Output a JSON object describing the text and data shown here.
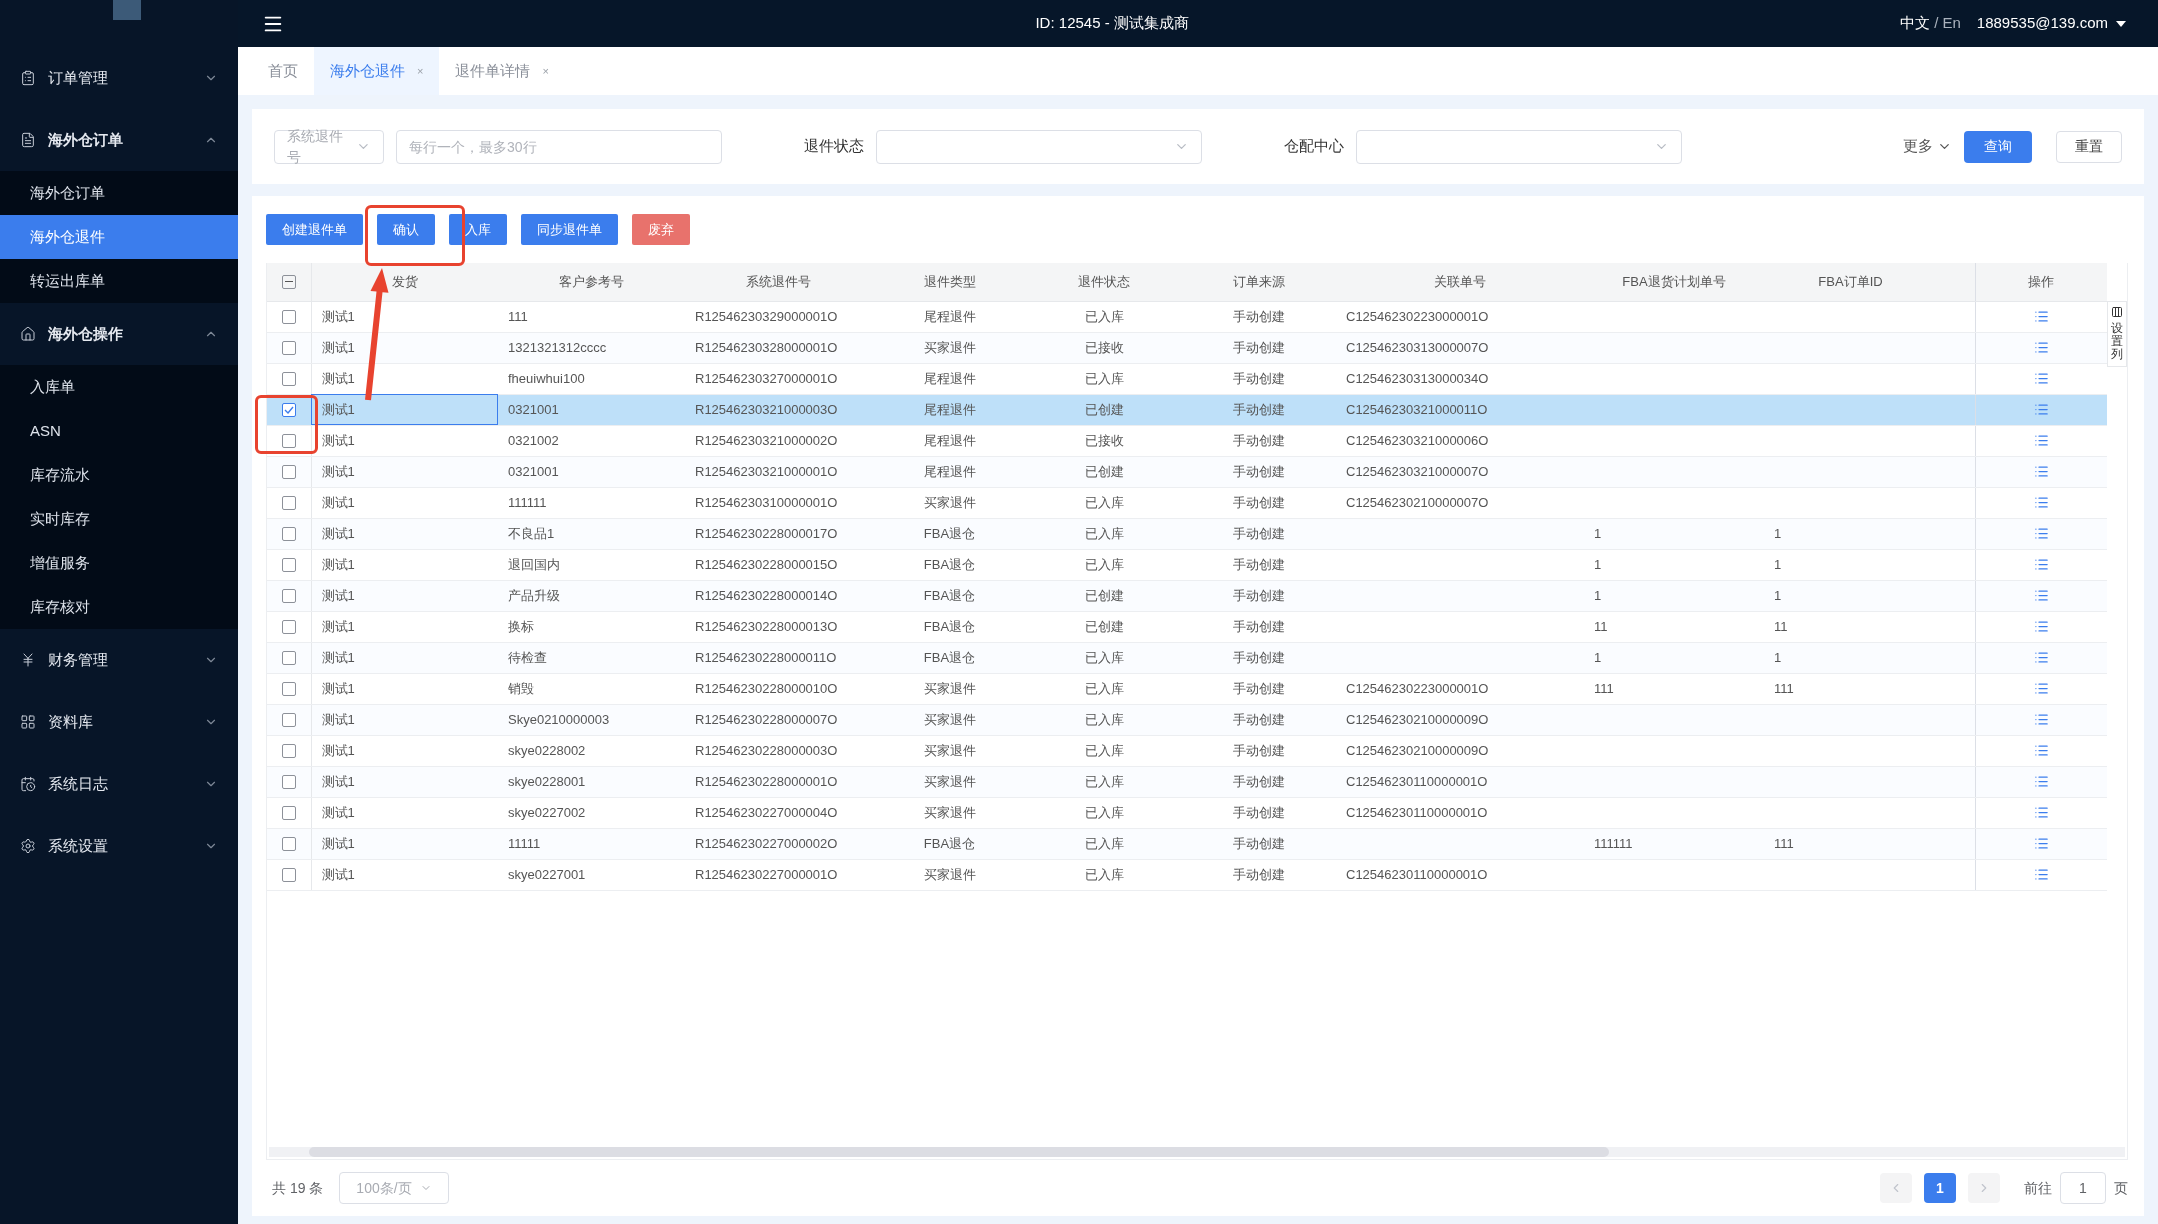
{
  "header": {
    "title": "ID: 12545 - 测试集成商",
    "lang_current": "中文",
    "lang_separator": "/",
    "lang_other": "En",
    "user": "1889535@139.com"
  },
  "sidebar": {
    "items": [
      {
        "label": "订单管理",
        "expanded": false
      },
      {
        "label": "海外仓订单",
        "expanded": true,
        "children": [
          {
            "label": "海外仓订单",
            "selected": false
          },
          {
            "label": "海外仓退件",
            "selected": true
          },
          {
            "label": "转运出库单",
            "selected": false
          }
        ]
      },
      {
        "label": "海外仓操作",
        "expanded": true,
        "children": [
          {
            "label": "入库单",
            "selected": false
          },
          {
            "label": "ASN",
            "selected": false
          },
          {
            "label": "库存流水",
            "selected": false
          },
          {
            "label": "实时库存",
            "selected": false
          },
          {
            "label": "增值服务",
            "selected": false
          },
          {
            "label": "库存核对",
            "selected": false
          }
        ]
      },
      {
        "label": "财务管理",
        "expanded": false
      },
      {
        "label": "资料库",
        "expanded": false
      },
      {
        "label": "系统日志",
        "expanded": false
      },
      {
        "label": "系统设置",
        "expanded": false
      }
    ]
  },
  "tabs": [
    {
      "label": "首页",
      "selected": false
    },
    {
      "label": "海外仓退件",
      "selected": true,
      "close": "×"
    },
    {
      "label": "退件单详情",
      "selected": false,
      "close": "×"
    }
  ],
  "filters": {
    "field_select": "系统退件号",
    "input_placeholder": "每行一个，最多30行",
    "status_label": "退件状态",
    "center_label": "仓配中心",
    "more": "更多",
    "query": "查询",
    "reset": "重置"
  },
  "toolbar": [
    {
      "label": "创建退件单",
      "kind": "primary"
    },
    {
      "label": "确认",
      "kind": "primary"
    },
    {
      "label": "入库",
      "kind": "primary"
    },
    {
      "label": "同步退件单",
      "kind": "primary"
    },
    {
      "label": "废弃",
      "kind": "danger"
    }
  ],
  "table": {
    "header_checkbox": {
      "indeterminate": true
    },
    "columns": [
      "发货",
      "客户参考号",
      "系统退件号",
      "退件类型",
      "退件状态",
      "订单来源",
      "关联单号",
      "FBA退货计划单号",
      "FBA订单ID",
      "操作"
    ],
    "rows": [
      {
        "selected": false,
        "cells": [
          "测试1",
          "111",
          "R12546230329000001O",
          "尾程退件",
          "已入库",
          "手动创建",
          "C12546230223000001O",
          "",
          ""
        ]
      },
      {
        "selected": false,
        "cells": [
          "测试1",
          "1321321312cccc",
          "R12546230328000001O",
          "买家退件",
          "已接收",
          "手动创建",
          "C12546230313000007O",
          "",
          ""
        ]
      },
      {
        "selected": false,
        "cells": [
          "测试1",
          "fheuiwhui100",
          "R12546230327000001O",
          "尾程退件",
          "已入库",
          "手动创建",
          "C12546230313000034O",
          "",
          ""
        ]
      },
      {
        "selected": true,
        "cells": [
          "测试1",
          "0321001",
          "R12546230321000003O",
          "尾程退件",
          "已创建",
          "手动创建",
          "C12546230321000011O",
          "",
          ""
        ]
      },
      {
        "selected": false,
        "cells": [
          "测试1",
          "0321002",
          "R12546230321000002O",
          "尾程退件",
          "已接收",
          "手动创建",
          "C12546230321000006O",
          "",
          ""
        ]
      },
      {
        "selected": false,
        "cells": [
          "测试1",
          "0321001",
          "R12546230321000001O",
          "尾程退件",
          "已创建",
          "手动创建",
          "C12546230321000007O",
          "",
          ""
        ]
      },
      {
        "selected": false,
        "cells": [
          "测试1",
          "111111",
          "R12546230310000001O",
          "买家退件",
          "已入库",
          "手动创建",
          "C12546230210000007O",
          "",
          ""
        ]
      },
      {
        "selected": false,
        "cells": [
          "测试1",
          "不良品1",
          "R12546230228000017O",
          "FBA退仓",
          "已入库",
          "手动创建",
          "",
          "1",
          "1"
        ]
      },
      {
        "selected": false,
        "cells": [
          "测试1",
          "退回国内",
          "R12546230228000015O",
          "FBA退仓",
          "已入库",
          "手动创建",
          "",
          "1",
          "1"
        ]
      },
      {
        "selected": false,
        "cells": [
          "测试1",
          "产品升级",
          "R12546230228000014O",
          "FBA退仓",
          "已创建",
          "手动创建",
          "",
          "1",
          "1"
        ]
      },
      {
        "selected": false,
        "cells": [
          "测试1",
          "换标",
          "R12546230228000013O",
          "FBA退仓",
          "已创建",
          "手动创建",
          "",
          "11",
          "11"
        ]
      },
      {
        "selected": false,
        "cells": [
          "测试1",
          "待检查",
          "R12546230228000011O",
          "FBA退仓",
          "已入库",
          "手动创建",
          "",
          "1",
          "1"
        ]
      },
      {
        "selected": false,
        "cells": [
          "测试1",
          "销毁",
          "R12546230228000010O",
          "买家退件",
          "已入库",
          "手动创建",
          "C12546230223000001O",
          "111",
          "111"
        ]
      },
      {
        "selected": false,
        "cells": [
          "测试1",
          "Skye0210000003",
          "R12546230228000007O",
          "买家退件",
          "已入库",
          "手动创建",
          "C12546230210000009O",
          "",
          ""
        ]
      },
      {
        "selected": false,
        "cells": [
          "测试1",
          "skye0228002",
          "R12546230228000003O",
          "买家退件",
          "已入库",
          "手动创建",
          "C12546230210000009O",
          "",
          ""
        ]
      },
      {
        "selected": false,
        "cells": [
          "测试1",
          "skye0228001",
          "R12546230228000001O",
          "买家退件",
          "已入库",
          "手动创建",
          "C12546230110000001O",
          "",
          ""
        ]
      },
      {
        "selected": false,
        "cells": [
          "测试1",
          "skye0227002",
          "R12546230227000004O",
          "买家退件",
          "已入库",
          "手动创建",
          "C12546230110000001O",
          "",
          ""
        ]
      },
      {
        "selected": false,
        "cells": [
          "测试1",
          "11111",
          "R12546230227000002O",
          "FBA退仓",
          "已入库",
          "手动创建",
          "",
          "111111",
          "111"
        ]
      },
      {
        "selected": false,
        "cells": [
          "测试1",
          "skye0227001",
          "R12546230227000001O",
          "买家退件",
          "已入库",
          "手动创建",
          "C12546230110000001O",
          "",
          ""
        ]
      }
    ],
    "column_settings": "设置列"
  },
  "pagination": {
    "total": "共 19 条",
    "page_size": "100条/页",
    "pages": [
      {
        "label": "1",
        "selected": true
      }
    ],
    "goto_label": "前往",
    "goto_value": "1",
    "goto_unit": "页"
  }
}
